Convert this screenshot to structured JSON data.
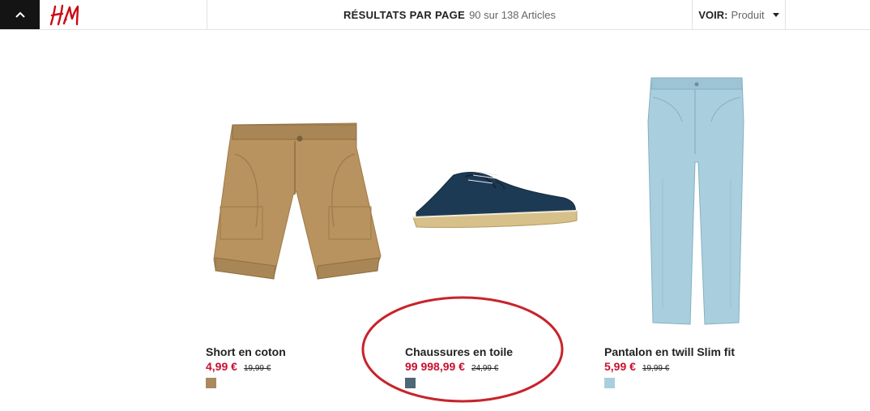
{
  "header": {
    "brand": "H&M",
    "results_label": "RÉSULTATS PAR PAGE",
    "results_count": "90 sur 138 Articles",
    "view_label": "VOIR:",
    "view_value": "Produit"
  },
  "products": [
    {
      "name": "Short en coton",
      "sale_price": "4,99 €",
      "original_price": "19,99 €",
      "swatch_color": "#a88a5e"
    },
    {
      "name": "Chaussures en toile",
      "sale_price": "99 998,99 €",
      "original_price": "24,99 €",
      "swatch_color": "#4e6676"
    },
    {
      "name": "Pantalon en twill Slim fit",
      "sale_price": "5,99 €",
      "original_price": "19,99 €",
      "swatch_color": "#a9cfde"
    }
  ],
  "colors": {
    "sale_red": "#c8102e",
    "annotation_red": "#c8232a",
    "header_dark": "#141414"
  }
}
